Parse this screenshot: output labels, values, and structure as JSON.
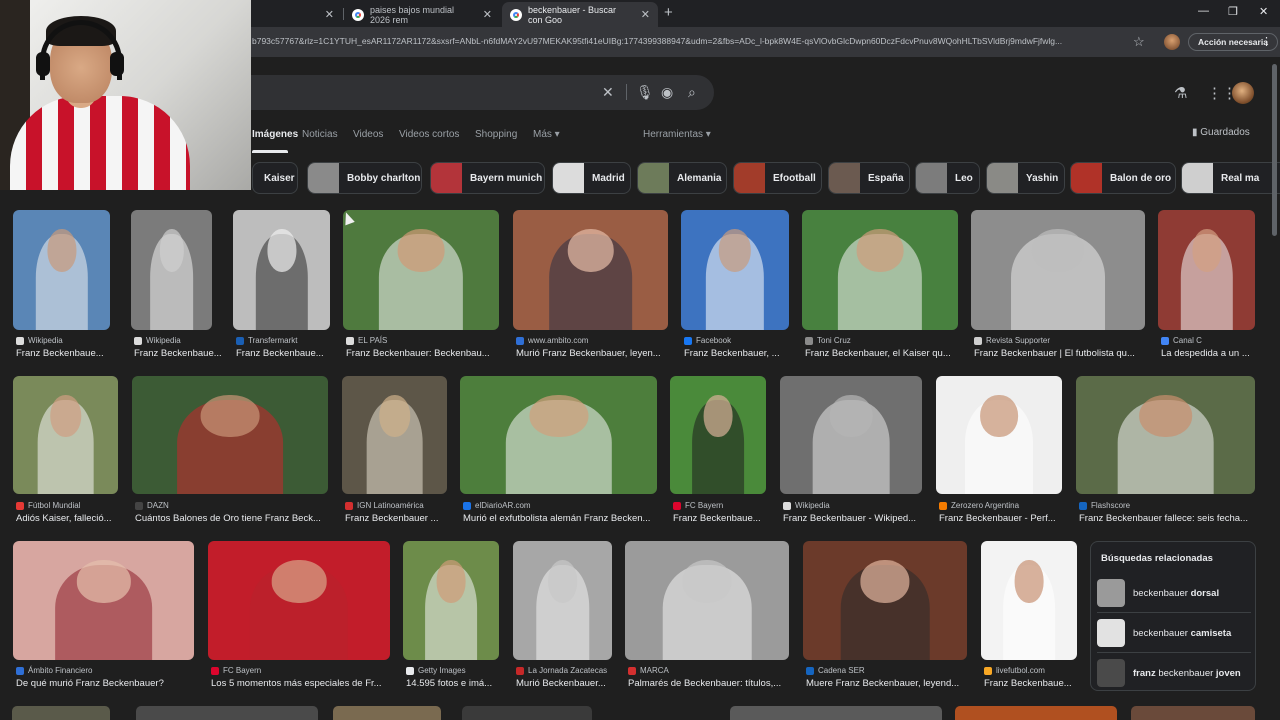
{
  "browser": {
    "tabs": [
      {
        "title": "",
        "active": false
      },
      {
        "title": "paises bajos mundial 2026 rem",
        "active": false
      },
      {
        "title": "beckenbauer - Buscar con Goo",
        "active": true
      }
    ],
    "url": "b793c57767&rlz=1C1YTUH_esAR1172AR1172&sxsrf=ANbL-n6fdMAY2vU97MEKAK95tfi41eUIBg:1774399388947&udm=2&fbs=ADc_l-bpk8W4E-qsVlOvbGlcDwpn60DczFdcvPnuv8WQohHLTbSVldBrj9mdwFjfwlg...",
    "accion_label": "Acción necesaria"
  },
  "nav": {
    "items": [
      "Imágenes",
      "Noticias",
      "Videos",
      "Videos cortos",
      "Shopping",
      "Más ▾",
      "Herramientas ▾"
    ],
    "saved": "Guardados"
  },
  "chips": [
    {
      "label": "Kaiser",
      "color": "#555"
    },
    {
      "label": "Bobby charlton",
      "color": "#8a8a8a"
    },
    {
      "label": "Bayern munich",
      "color": "#b3343a"
    },
    {
      "label": "Madrid",
      "color": "#dcdcdc"
    },
    {
      "label": "Alemania",
      "color": "#6d7b5a"
    },
    {
      "label": "Efootball",
      "color": "#a23c2a"
    },
    {
      "label": "España",
      "color": "#6b5a50"
    },
    {
      "label": "Leo",
      "color": "#7c7c7c"
    },
    {
      "label": "Yashin",
      "color": "#8a8a86"
    },
    {
      "label": "Balon de oro",
      "color": "#b03228"
    },
    {
      "label": "Real ma",
      "color": "#cfcfcf"
    }
  ],
  "results_row1": [
    {
      "source": "Wikipedia",
      "caption": "Franz Beckenbaue...",
      "bg": "#5a86b6",
      "fig": "#f1f1f1",
      "face": "#c99a7a",
      "dot": "#dcdcdc"
    },
    {
      "source": "Wikipedia",
      "caption": "Franz Beckenbaue...",
      "bg": "#7b7b7b",
      "fig": "#f0f0f0",
      "face": "#cfcfcf",
      "dot": "#dcdcdc"
    },
    {
      "source": "Transfermarkt",
      "caption": "Franz Beckenbaue...",
      "bg": "#bdbdbd",
      "fig": "#2b2b2b",
      "face": "#efefef",
      "dot": "#1a5fb4"
    },
    {
      "source": "EL PAÍS",
      "caption": "Franz Beckenbauer: Beckenbau...",
      "bg": "#4f7a3e",
      "fig": "#f4f4f4",
      "face": "#d29a76",
      "dot": "#dcdcdc"
    },
    {
      "source": "www.ambito.com",
      "caption": "Murió Franz Beckenbauer, leyen...",
      "bg": "#9a5d44",
      "fig": "#2d2f45",
      "face": "#e7bda8",
      "dot": "#2f6fd6"
    },
    {
      "source": "Facebook",
      "caption": "Franz Beckenbauer, ...",
      "bg": "#3d73c0",
      "fig": "#fbfbfb",
      "face": "#c99b7d",
      "dot": "#1877f2"
    },
    {
      "source": "Toni Cruz",
      "caption": "Franz Beckenbauer, el Kaiser qu...",
      "bg": "#48813f",
      "fig": "#f3f3f3",
      "face": "#d09d7c",
      "dot": "#8a8a8a"
    },
    {
      "source": "Revista Supporter",
      "caption": "Franz Beckenbauer | El futbolista qu...",
      "bg": "#8d8d8d",
      "fig": "#e9e9e9",
      "face": "#bdbdbd",
      "dot": "#cfcfcf"
    },
    {
      "source": "Canal C",
      "caption": "La despedida a un ...",
      "bg": "#8f3b34",
      "fig": "#f4f4f4",
      "face": "#d39f82",
      "dot": "#4285f4"
    }
  ],
  "results_row2": [
    {
      "source": "Fútbol Mundial",
      "caption": "Adiós Kaiser, falleció...",
      "bg": "#7a8a5a",
      "fig": "#f4f4f4",
      "face": "#d09e82",
      "dot": "#e53935"
    },
    {
      "source": "DAZN",
      "caption": "Cuántos Balones de Oro tiene Franz Beck...",
      "bg": "#3c5b35",
      "fig": "#c8262c",
      "face": "#c99678",
      "dot": "#444"
    },
    {
      "source": "IGN Latinoamérica",
      "caption": "Franz Beckenbauer ...",
      "bg": "#5d5648",
      "fig": "#e6e0cf",
      "face": "#cfb08a",
      "dot": "#d32f2f"
    },
    {
      "source": "elDiarioAR.com",
      "caption": "Murió el exfutbolista alemán Franz Becken...",
      "bg": "#4d7e3c",
      "fig": "#f4f4f4",
      "face": "#d2a07c",
      "dot": "#1a73e8"
    },
    {
      "source": "FC Bayern",
      "caption": "Franz Beckenbaue...",
      "bg": "#4a8a3a",
      "fig": "#1d1d1d",
      "face": "#d9b099",
      "dot": "#dc052d"
    },
    {
      "source": "Wikipedia",
      "caption": "Franz Beckenbauer - Wikiped...",
      "bg": "#6f6f6f",
      "fig": "#e4e4e4",
      "face": "#b5b5b5",
      "dot": "#dcdcdc"
    },
    {
      "source": "Zerozero Argentina",
      "caption": "Franz Beckenbauer - Perf...",
      "bg": "#efefef",
      "fig": "#ffffff",
      "face": "#c79475",
      "dot": "#f57c00"
    },
    {
      "source": "Flashscore",
      "caption": "Franz Beckenbauer fallece: seis fecha...",
      "bg": "#5b6b48",
      "fig": "#f3f3f3",
      "face": "#c98f6e",
      "dot": "#1565c0"
    }
  ],
  "results_row3": [
    {
      "source": "Ámbito Financiero",
      "caption": "De qué murió Franz Beckenbauer?",
      "bg": "#d7a6a0",
      "fig": "#8d1e2a",
      "face": "#e6c1ad",
      "dot": "#2f6fd6"
    },
    {
      "source": "FC Bayern",
      "caption": "Los 5 momentos más especiales de Fr...",
      "bg": "#c21d2a",
      "fig": "#b8222c",
      "face": "#d9a78a",
      "dot": "#dc052d"
    },
    {
      "source": "Getty Images",
      "caption": "14.595 fotos e imá...",
      "bg": "#6d8c4a",
      "fig": "#f4f4f4",
      "face": "#cf9b78",
      "dot": "#e8eaed"
    },
    {
      "source": "La Jornada Zacatecas",
      "caption": "Murió Beckenbauer...",
      "bg": "#a7a7a7",
      "fig": "#f0f0f0",
      "face": "#c8c8c8",
      "dot": "#c62828"
    },
    {
      "source": "MARCA",
      "caption": "Palmarés de Beckenbauer: títulos,...",
      "bg": "#9b9b9b",
      "fig": "#f2f2f2",
      "face": "#c7c7c7",
      "dot": "#d32f2f"
    },
    {
      "source": "Cadena SER",
      "caption": "Muere Franz Beckenbauer, leyend...",
      "bg": "#6b3a2a",
      "fig": "#2a2a2a",
      "face": "#e3b7a0",
      "dot": "#1565c0"
    },
    {
      "source": "livefutbol.com",
      "caption": "Franz Beckenbaue...",
      "bg": "#f3f3f3",
      "fig": "#ffffff",
      "face": "#c79273",
      "dot": "#f9a825"
    }
  ],
  "related": {
    "title": "Búsquedas relacionadas",
    "items": [
      {
        "normal": "beckenbauer ",
        "bold": "dorsal",
        "color": "#9a9a9a"
      },
      {
        "normal": "beckenbauer ",
        "bold": "camiseta",
        "color": "#e2e2e2"
      },
      {
        "normal": "",
        "bold": "franz",
        "normal2": " beckenbauer ",
        "bold2": "joven",
        "color": "#4a4a4a"
      }
    ]
  }
}
